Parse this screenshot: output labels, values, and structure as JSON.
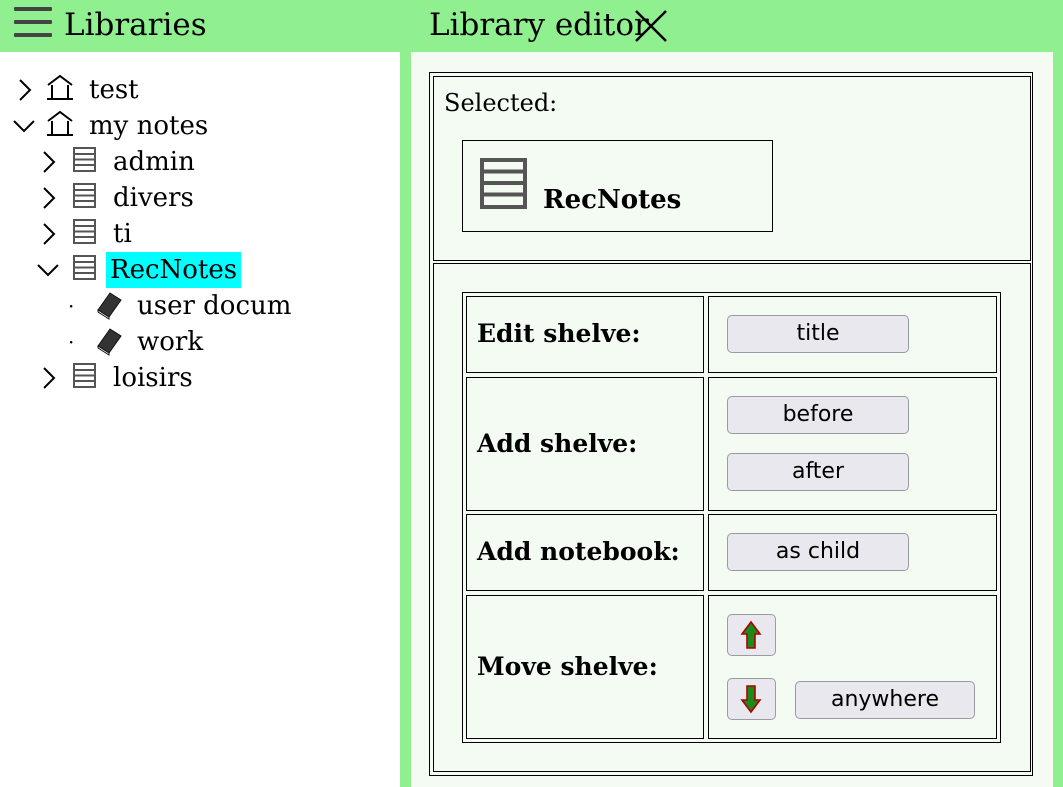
{
  "left": {
    "title": "Libraries",
    "tree": [
      {
        "label": "test",
        "icon": "library-icon",
        "expanded": false,
        "level": 0
      },
      {
        "label": "my notes",
        "icon": "library-icon",
        "expanded": true,
        "level": 0
      },
      {
        "label": "admin",
        "icon": "shelf-icon",
        "expanded": false,
        "level": 1
      },
      {
        "label": "divers",
        "icon": "shelf-icon",
        "expanded": false,
        "level": 1
      },
      {
        "label": "ti",
        "icon": "shelf-icon",
        "expanded": false,
        "level": 1
      },
      {
        "label": "RecNotes",
        "icon": "shelf-icon",
        "expanded": true,
        "level": 1,
        "selected": true
      },
      {
        "label": "user docum",
        "icon": "notebook-icon",
        "level": 2
      },
      {
        "label": "work",
        "icon": "notebook-icon",
        "level": 2
      },
      {
        "label": "loisirs",
        "icon": "shelf-icon",
        "expanded": false,
        "level": 1
      }
    ],
    "selected_color": "#00ffff"
  },
  "right": {
    "title": "Library editor",
    "selected_label": "Selected:",
    "selected_name": "RecNotes",
    "rows": {
      "edit": {
        "label": "Edit shelve:",
        "buttons": [
          "title"
        ]
      },
      "add": {
        "label": "Add shelve:",
        "buttons": [
          "before",
          "after"
        ]
      },
      "notebook": {
        "label": "Add notebook:",
        "buttons": [
          "as child"
        ]
      },
      "move": {
        "label": "Move shelve:",
        "buttons": [
          "move-up-arrow",
          "move-down-arrow",
          "anywhere"
        ]
      }
    }
  },
  "colors": {
    "header_green": "#90f090",
    "editor_bg": "#f3fbf3",
    "arrow_fill": "#1a8a1a",
    "arrow_stroke": "#b00000"
  }
}
